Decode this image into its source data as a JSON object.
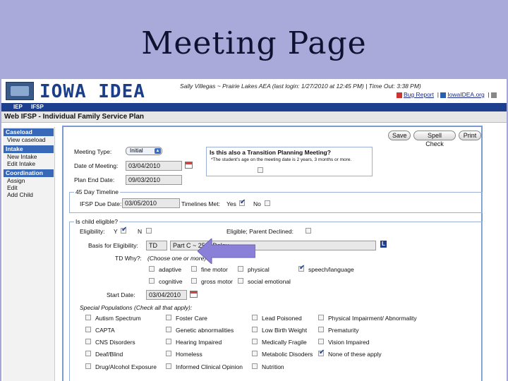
{
  "slide": {
    "title": "Meeting Page"
  },
  "app": {
    "logo_text": "IOWA IDEA",
    "user_info": "Sally Villegas ~ Prairie Lakes AEA   (last login: 1/27/2010 at 12:45 PM)   |  Time Out: 3:38 PM)",
    "bug_report": "Bug Report",
    "iowaidea_link": "IowaIDEA.org"
  },
  "nav": {
    "tabs": [
      "IEP",
      "IFSP"
    ]
  },
  "page_header": "Web IFSP - Individual Family Service Plan",
  "sidebar": {
    "caseload": {
      "header": "Caseload",
      "items": [
        "View caseload"
      ]
    },
    "intake": {
      "header": "Intake",
      "items": [
        "New Intake",
        "Edit Intake"
      ]
    },
    "coordination": {
      "header": "Coordination",
      "items": [
        "Assign",
        "Edit",
        "Add Child"
      ]
    }
  },
  "toolbar": {
    "save": "Save",
    "spell_check": "Spell Check",
    "print": "Print"
  },
  "meeting": {
    "type_label": "Meeting Type:",
    "type_value": "Initial",
    "date_label": "Date of Meeting:",
    "date_value": "03/04/2010",
    "plan_end_label": "Plan End Date:",
    "plan_end_value": "09/03/2010"
  },
  "transition": {
    "question": "Is this also a Transition Planning Meeting?",
    "note": "*The student's age on the meeting date is 2 years, 3 months or more."
  },
  "timeline": {
    "legend": "45 Day Timeline",
    "due_label": "IFSP Due Date:",
    "due_value": "03/05/2010",
    "met_label": "Timelines Met:",
    "yes": "Yes",
    "no": "No",
    "met_yes_checked": true,
    "met_no_checked": false
  },
  "eligibility": {
    "legend": "Is child eligible?",
    "eligibility_label": "Eligibility:",
    "y": "Y",
    "n": "N",
    "y_checked": true,
    "n_checked": false,
    "parent_declined_label": "Eligible; Parent Declined:",
    "basis_label": "Basis for Eligibility:",
    "basis_code": "TD",
    "basis_text": "Part C ~ 25% Delay",
    "l_button": "L",
    "td_why_label": "TD Why?:",
    "td_why_hint": "(Choose one or more)",
    "td_options": [
      {
        "label": "adaptive",
        "checked": false
      },
      {
        "label": "fine motor",
        "checked": false
      },
      {
        "label": "physical",
        "checked": false
      },
      {
        "label": "speech/language",
        "checked": true
      },
      {
        "label": "cognitive",
        "checked": false
      },
      {
        "label": "gross motor",
        "checked": false
      },
      {
        "label": "social emotional",
        "checked": false
      }
    ],
    "start_label": "Start Date:",
    "start_value": "03/04/2010"
  },
  "special_populations": {
    "label": "Special Populations",
    "hint": "(Check all that apply):",
    "items": [
      {
        "label": "Autism Spectrum",
        "checked": false
      },
      {
        "label": "Foster Care",
        "checked": false
      },
      {
        "label": "Lead Poisoned",
        "checked": false
      },
      {
        "label": "Physical Impairment/ Abnormality",
        "checked": false
      },
      {
        "label": "CAPTA",
        "checked": false
      },
      {
        "label": "Genetic abnormalities",
        "checked": false
      },
      {
        "label": "Low Birth Weight",
        "checked": false
      },
      {
        "label": "Prematurity",
        "checked": false
      },
      {
        "label": "CNS Disorders",
        "checked": false
      },
      {
        "label": "Hearing Impaired",
        "checked": false
      },
      {
        "label": "Medically Fragile",
        "checked": false
      },
      {
        "label": "Vision Impaired",
        "checked": false
      },
      {
        "label": "Deaf/Blind",
        "checked": false
      },
      {
        "label": "Homeless",
        "checked": false
      },
      {
        "label": "Metabolic Disoders",
        "checked": false
      },
      {
        "label": "None of these apply",
        "checked": true
      },
      {
        "label": "Drug/Alcohol Exposure",
        "checked": false
      },
      {
        "label": "Informed Clinical Opinion",
        "checked": false
      },
      {
        "label": "Nutrition",
        "checked": false
      }
    ]
  },
  "colors": {
    "slide_bg": "#a9a9da",
    "nav_blue": "#1e3f8e",
    "sidebar_header": "#3869b8",
    "arrow": "#8a80d8"
  }
}
